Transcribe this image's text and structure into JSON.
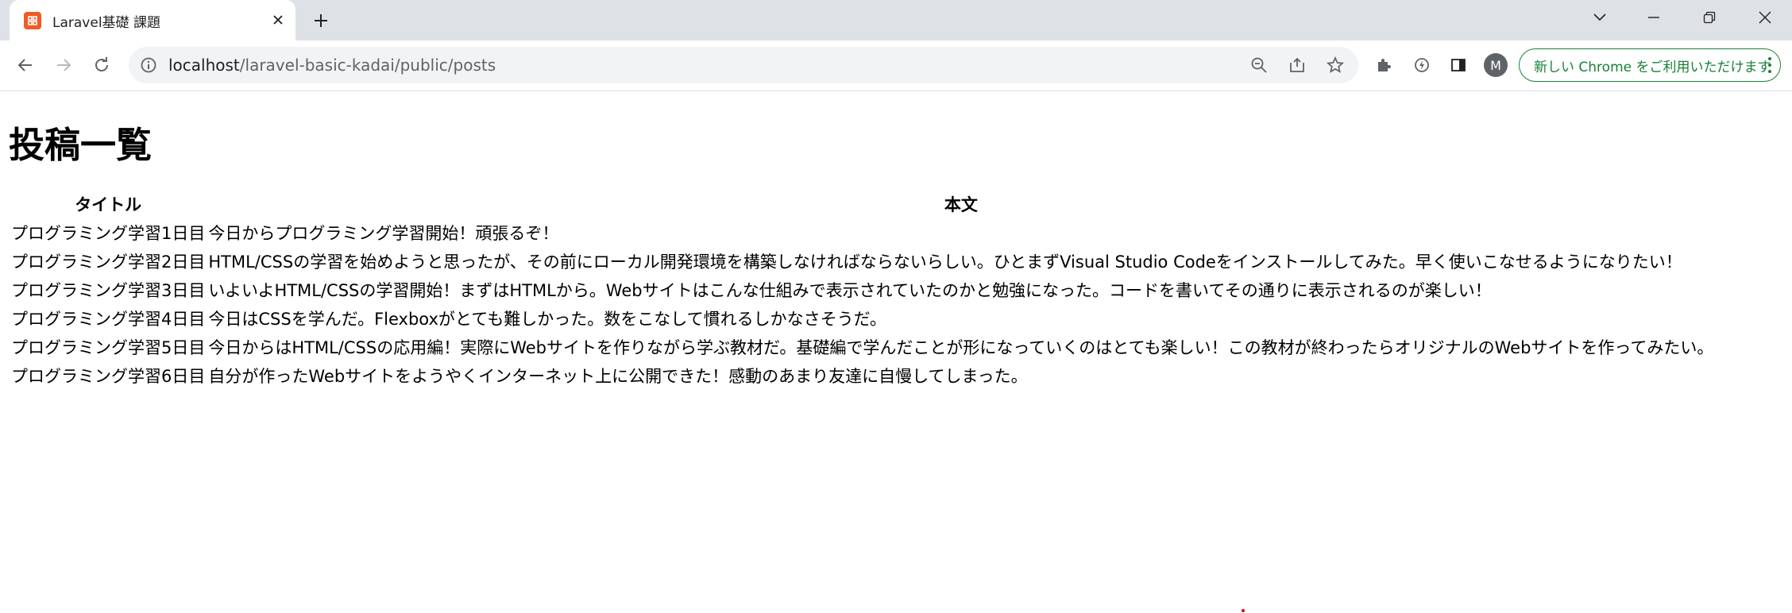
{
  "browser": {
    "tab": {
      "title": "Laravel基礎 課題"
    },
    "address_bar": {
      "host": "localhost",
      "path": "/laravel-basic-kadai/public/posts"
    },
    "profile_initial": "M",
    "update_button_label": "新しい Chrome をご利用いただけます",
    "colors": {
      "tab_strip": "#dee1e6",
      "omnibox": "#f1f3f4",
      "update_accent": "#188038",
      "favicon": "#f15a24"
    },
    "icons": [
      "back-icon",
      "forward-icon",
      "reload-icon",
      "info-icon",
      "zoom-out-icon",
      "share-icon",
      "star-icon",
      "extensions-icon",
      "performance-icon",
      "side-panel-icon",
      "tab-search-icon",
      "minimize-icon",
      "restore-icon",
      "close-icon"
    ]
  },
  "page": {
    "heading": "投稿一覧",
    "table": {
      "headers": {
        "title": "タイトル",
        "body": "本文"
      },
      "rows": [
        {
          "title": "プログラミング学習1日目",
          "body": "今日からプログラミング学習開始！頑張るぞ！"
        },
        {
          "title": "プログラミング学習2日目",
          "body": "HTML/CSSの学習を始めようと思ったが、その前にローカル開発環境を構築しなければならないらしい。ひとまずVisual Studio Codeをインストールしてみた。早く使いこなせるようになりたい！"
        },
        {
          "title": "プログラミング学習3日目",
          "body": "いよいよHTML/CSSの学習開始！まずはHTMLから。Webサイトはこんな仕組みで表示されていたのかと勉強になった。コードを書いてその通りに表示されるのが楽しい！"
        },
        {
          "title": "プログラミング学習4日目",
          "body": "今日はCSSを学んだ。Flexboxがとても難しかった。数をこなして慣れるしかなさそうだ。"
        },
        {
          "title": "プログラミング学習5日目",
          "body": "今日からはHTML/CSSの応用編！実際にWebサイトを作りながら学ぶ教材だ。基礎編で学んだことが形になっていくのはとても楽しい！この教材が終わったらオリジナルのWebサイトを作ってみたい。"
        },
        {
          "title": "プログラミング学習6日目",
          "body": "自分が作ったWebサイトをようやくインターネット上に公開できた！感動のあまり友達に自慢してしまった。"
        }
      ]
    }
  }
}
